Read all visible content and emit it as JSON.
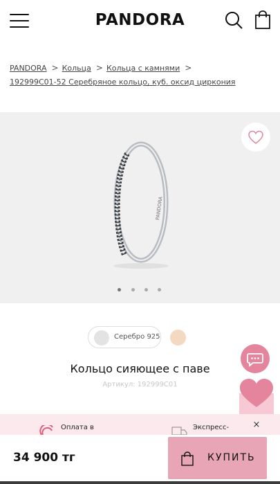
{
  "header": {
    "logo": "PANDORA",
    "icons": [
      "menu-icon",
      "search-icon",
      "shopping-bag-icon"
    ]
  },
  "breadcrumbs": {
    "items": [
      "PANDORA",
      "Кольца",
      "Кольца с камнями",
      "192999C01-52 Серебряное кольцо, куб. оксид циркония"
    ]
  },
  "gallery": {
    "slide_count": 4,
    "active_slide": 1,
    "ring_engraving": "PANDORA"
  },
  "product": {
    "metal_option": "Серебро 925",
    "title": "Кольцо сияющее с паве",
    "sku": "Артикул: 192999C01"
  },
  "info_strip": {
    "payment_text": "Оплата в",
    "express_text": "Экспресс-",
    "close_glyph": "×"
  },
  "purchase": {
    "price": "34 900 тг",
    "buy_label": "КУПИТЬ"
  },
  "colors": {
    "accent_pink": "#e4859d",
    "buy_button": "#e8a5b5",
    "info_strip_bg": "#fbe9ee",
    "gallery_bg": "#f0f0f0"
  }
}
